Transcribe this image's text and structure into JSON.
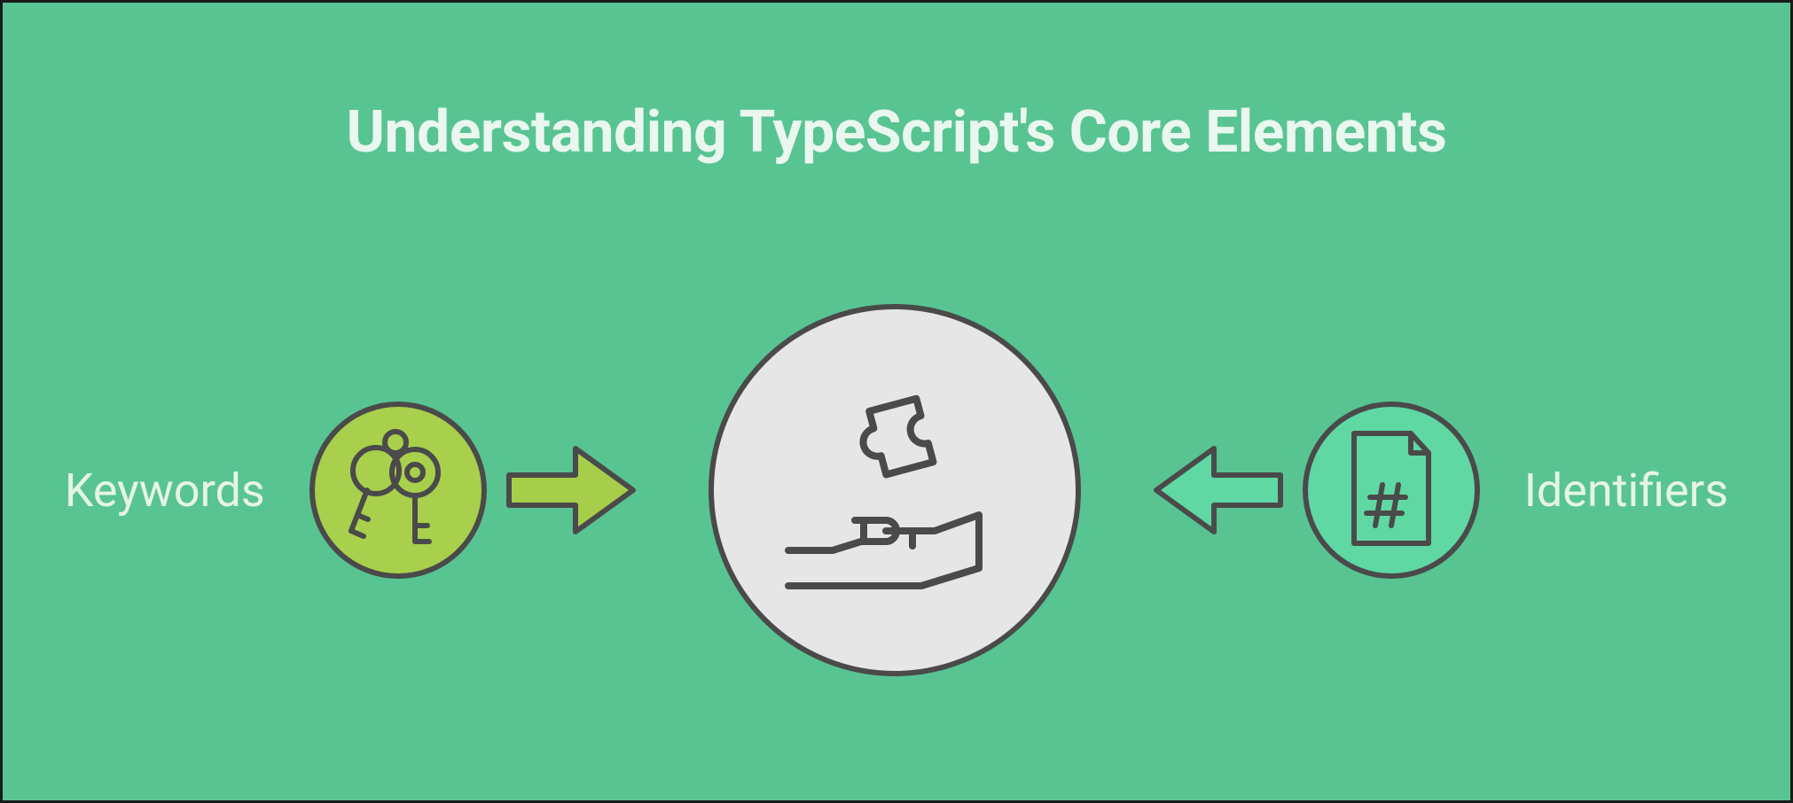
{
  "title": "Understanding TypeScript's Core Elements",
  "left": {
    "label": "Keywords"
  },
  "right": {
    "label": "Identifiers"
  },
  "colors": {
    "background": "#58c492",
    "title_text": "#e9f7ef",
    "label_text": "#e6f4e8",
    "stroke": "#4a4a4a",
    "keywords_circle": "#a8d04c",
    "identifiers_circle": "#5fd8a4",
    "center_circle": "#e6e6e6",
    "arrow_fill_left": "#a6ce4b",
    "arrow_fill_right": "#5fd8a4"
  }
}
